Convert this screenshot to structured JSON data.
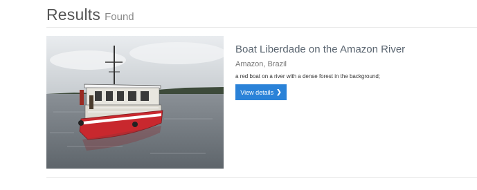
{
  "header": {
    "title": "Results",
    "subtitle": "Found"
  },
  "results": [
    {
      "title": "Boat Liberdade on the Amazon River",
      "location": "Amazon, Brazil",
      "description": "a red boat on a river with a dense forest in the background;",
      "button_label": "View details",
      "button_icon": "chevron-right-icon"
    }
  ],
  "colors": {
    "accent": "#2a82d8",
    "boat_hull": "#c8282e"
  }
}
